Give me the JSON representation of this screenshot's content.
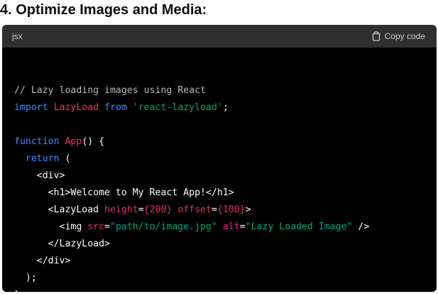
{
  "heading": "4. Optimize Images and Media:",
  "code_header": {
    "language": "jsx",
    "copy_label": "Copy code",
    "copy_icon": "clipboard-icon"
  },
  "colors": {
    "code_bg": "#000000",
    "header_bg": "#2f2f2f",
    "comment": "#b8b8b8",
    "keyword": "#3a8fff",
    "name": "#f2344f",
    "string": "#00a67d",
    "attr": "#e9297a"
  },
  "code_lines": [
    [
      {
        "t": "// Lazy loading images using React",
        "c": "comment"
      }
    ],
    [
      {
        "t": "import",
        "c": "keyword"
      },
      {
        "t": " ",
        "c": "plain"
      },
      {
        "t": "LazyLoad",
        "c": "name"
      },
      {
        "t": " ",
        "c": "plain"
      },
      {
        "t": "from",
        "c": "keyword"
      },
      {
        "t": " ",
        "c": "plain"
      },
      {
        "t": "'react-lazyload'",
        "c": "string"
      },
      {
        "t": ";",
        "c": "plain"
      }
    ],
    [],
    [
      {
        "t": "function",
        "c": "keyword"
      },
      {
        "t": " ",
        "c": "plain"
      },
      {
        "t": "App",
        "c": "name"
      },
      {
        "t": "() {",
        "c": "plain"
      }
    ],
    [
      {
        "t": "  ",
        "c": "plain"
      },
      {
        "t": "return",
        "c": "keyword"
      },
      {
        "t": " (",
        "c": "plain"
      }
    ],
    [
      {
        "t": "    <div>",
        "c": "plain"
      }
    ],
    [
      {
        "t": "      <h1>Welcome to My React App!</h1>",
        "c": "plain"
      }
    ],
    [
      {
        "t": "      <LazyLoad ",
        "c": "plain"
      },
      {
        "t": "height",
        "c": "attr"
      },
      {
        "t": "=",
        "c": "plain"
      },
      {
        "t": "{200}",
        "c": "attr"
      },
      {
        "t": " ",
        "c": "plain"
      },
      {
        "t": "offset",
        "c": "attr"
      },
      {
        "t": "=",
        "c": "plain"
      },
      {
        "t": "{100}",
        "c": "attr"
      },
      {
        "t": ">",
        "c": "plain"
      }
    ],
    [
      {
        "t": "        <img ",
        "c": "plain"
      },
      {
        "t": "src",
        "c": "attr"
      },
      {
        "t": "=",
        "c": "plain"
      },
      {
        "t": "\"path/to/image.jpg\"",
        "c": "string"
      },
      {
        "t": " ",
        "c": "plain"
      },
      {
        "t": "alt",
        "c": "attr"
      },
      {
        "t": "=",
        "c": "plain"
      },
      {
        "t": "\"Lazy Loaded Image\"",
        "c": "string"
      },
      {
        "t": " />",
        "c": "plain"
      }
    ],
    [
      {
        "t": "      </LazyLoad>",
        "c": "plain"
      }
    ],
    [
      {
        "t": "    </div>",
        "c": "plain"
      }
    ],
    [
      {
        "t": "  );",
        "c": "plain"
      }
    ],
    [
      {
        "t": "}",
        "c": "plain"
      }
    ]
  ]
}
